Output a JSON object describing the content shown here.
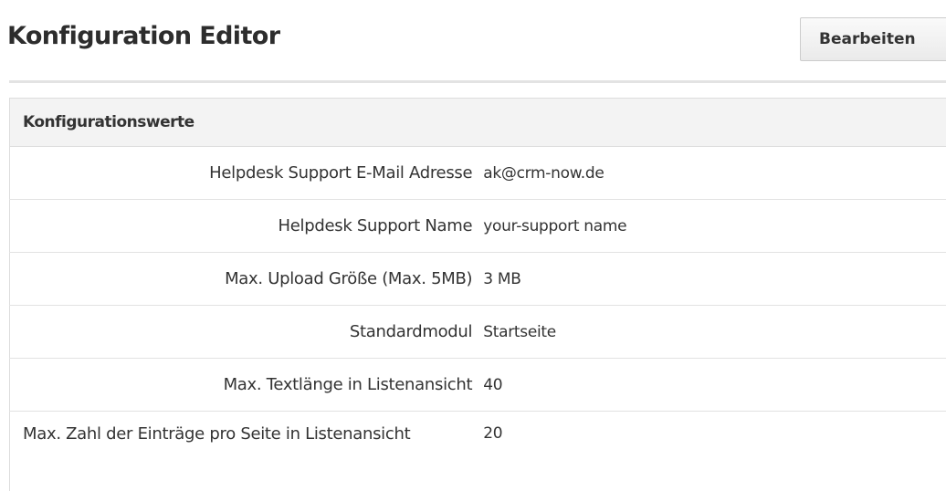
{
  "header": {
    "title": "Konfiguration Editor",
    "edit_label": "Bearbeiten"
  },
  "table": {
    "heading": "Konfigurationswerte",
    "rows": [
      {
        "label": "Helpdesk Support E-Mail Adresse",
        "value": "ak@crm-now.de"
      },
      {
        "label": "Helpdesk Support Name",
        "value": "your-support name"
      },
      {
        "label": "Max. Upload Größe (Max. 5MB)",
        "value": "3 MB"
      },
      {
        "label": "Standardmodul",
        "value": "Startseite"
      },
      {
        "label": "Max. Textlänge in Listenansicht",
        "value": "40"
      },
      {
        "label": "Max. Zahl der Einträge pro Seite in Listenansicht",
        "value": "20"
      }
    ]
  }
}
